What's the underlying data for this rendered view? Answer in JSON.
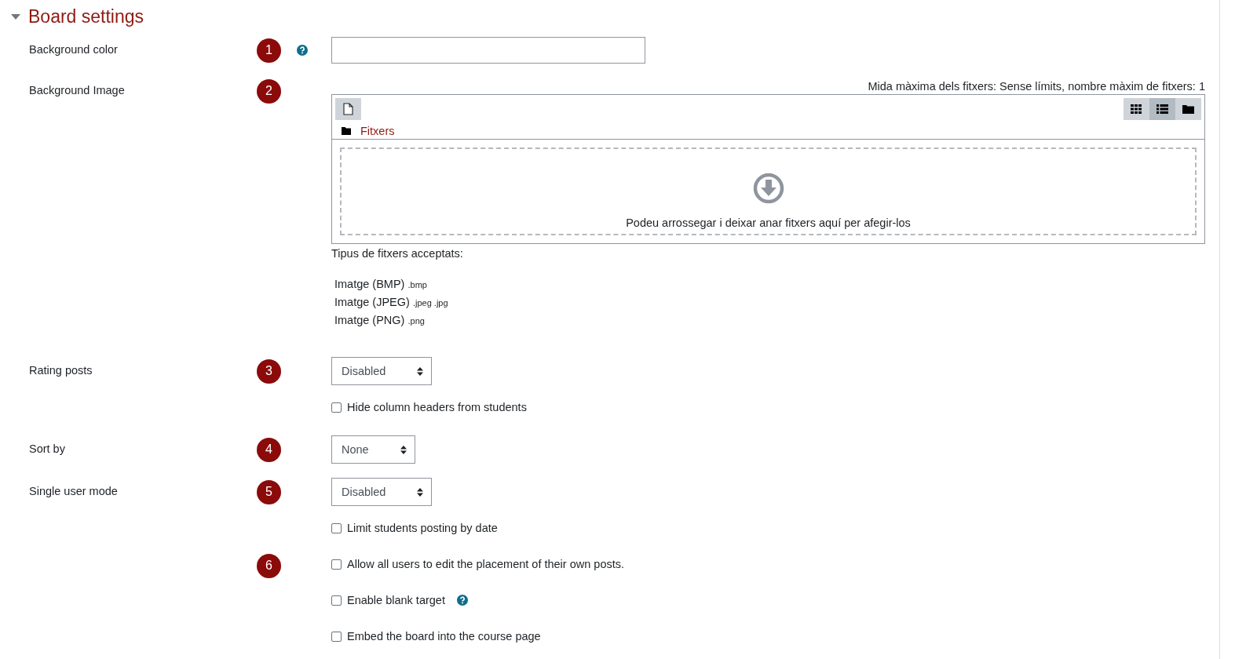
{
  "section": {
    "title": "Board settings",
    "expanded": true
  },
  "rows": [
    {
      "kind": "text",
      "label": "Background color",
      "badge": "1",
      "help": true,
      "value": ""
    },
    {
      "kind": "filepicker",
      "label": "Background Image",
      "badge": "2",
      "max_size": "Mida màxima dels fitxers: Sense límits, nombre màxim de fitxers: 1",
      "views": [
        {
          "kind": "grid",
          "selected": false
        },
        {
          "kind": "list",
          "selected": true
        },
        {
          "kind": "tree",
          "selected": false
        }
      ],
      "path": "Fitxers",
      "drop_text": "Podeu arrossegar i deixar anar fitxers aquí per afegir-los",
      "accepted_title": "Tipus de fitxers acceptats:",
      "accepted": [
        {
          "name": "Imatge (BMP)",
          "ext": ".bmp"
        },
        {
          "name": "Imatge (JPEG)",
          "ext": ".jpeg .jpg"
        },
        {
          "name": "Imatge (PNG)",
          "ext": ".png"
        }
      ]
    },
    {
      "kind": "select",
      "label": "Rating posts",
      "badge": "3",
      "value": "Disabled"
    },
    {
      "kind": "checkbox",
      "text": "Hide column headers from students",
      "checked": false
    },
    {
      "kind": "select",
      "label": "Sort by",
      "badge": "4",
      "value": "None"
    },
    {
      "kind": "select",
      "label": "Single user mode",
      "badge": "5",
      "value": "Disabled"
    },
    {
      "kind": "checkbox",
      "text": "Limit students posting by date",
      "checked": false
    },
    {
      "kind": "checkbox",
      "badge": "6",
      "text": "Allow all users to edit the placement of their own posts.",
      "checked": false
    },
    {
      "kind": "checkbox",
      "text": "Enable blank target",
      "checked": false,
      "help": true
    },
    {
      "kind": "checkbox",
      "text": "Embed the board into the course page",
      "checked": false
    }
  ]
}
